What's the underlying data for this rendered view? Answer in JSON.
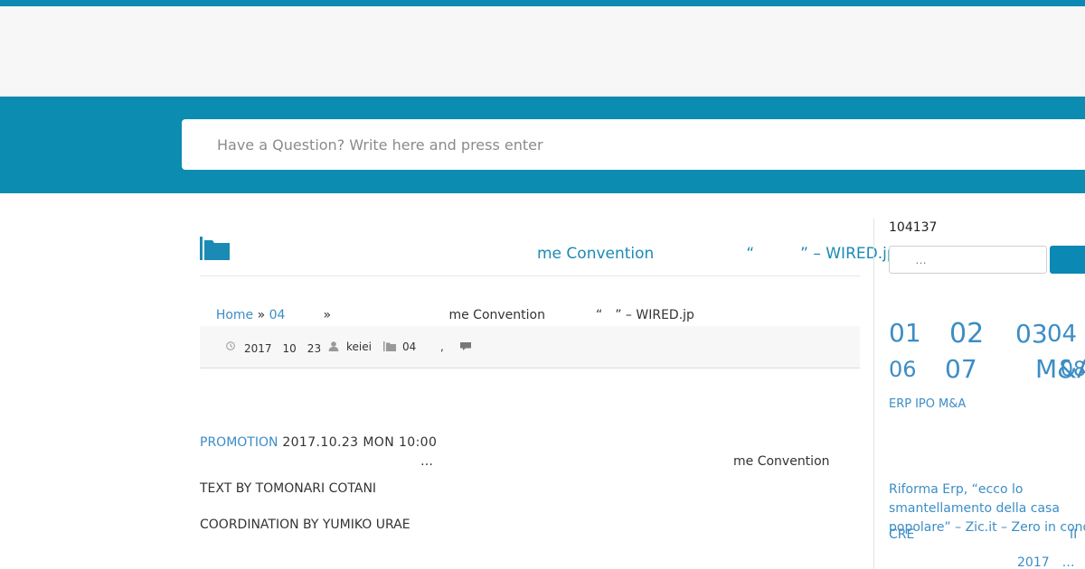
{
  "colors": {
    "brand": "#0b8cb0",
    "link": "#3c8dc5",
    "title": "#1b8ab4"
  },
  "search": {
    "placeholder": "Have a Question? Write here and press enter"
  },
  "post": {
    "title": "me Convention　　　　　　“　　　” – WIRED.jp",
    "folder_icon": "folder-icon"
  },
  "breadcrumb": {
    "home": "Home",
    "sep": " » ",
    "category": "04",
    "sep2": "　　　» ",
    "current": "　　　　　　　　　me Convention　　　　“　” – WIRED.jp"
  },
  "meta": {
    "date": "2017　10　23",
    "author": "keiei",
    "category": "04",
    "separator": ","
  },
  "article": {
    "promotion": "PROMOTION",
    "dateline": " 2017.10.23 MON 10:00",
    "ellipsis": "…",
    "event": "me Convention",
    "credit_text": "TEXT BY TOMONARI COTANI",
    "credit_coord": "COORDINATION BY YUMIKO URAE"
  },
  "sidebar": {
    "counter": "104137",
    "search_placeholder": "…",
    "tags_large": [
      "01",
      "02",
      "03",
      "04",
      "06",
      "07",
      "M&A",
      "08"
    ],
    "tags_small": [
      "ERP",
      "IPO",
      "M&A"
    ],
    "related_title": "Riforma Erp, “ecco lo smantellamento della casa popolare” – Zic.it – Zero in condotta",
    "related_category": "CRE",
    "related_category_2": "II",
    "related_date": "2017　…"
  }
}
